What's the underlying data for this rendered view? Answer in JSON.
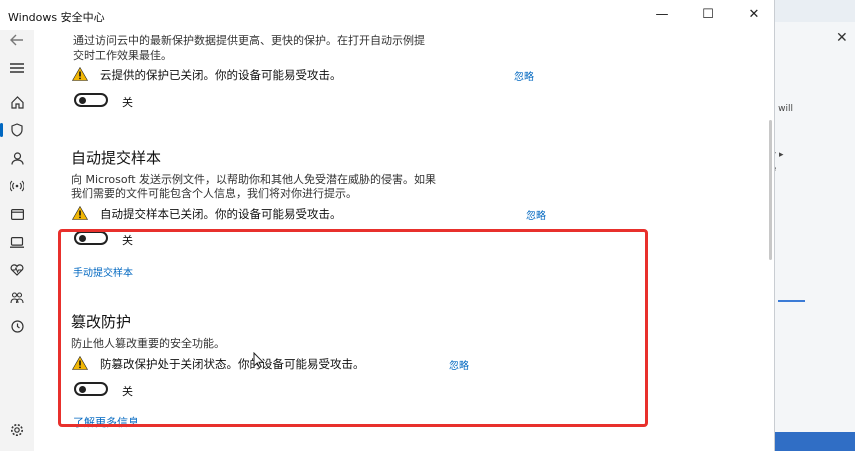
{
  "window": {
    "title": "Windows 安全中心",
    "min_glyph": "—",
    "max_glyph": "☐",
    "close_glyph": "✕"
  },
  "nav_icons": [
    "back-arrow-icon",
    "hamburger-menu-icon",
    "home-icon",
    "shield-icon",
    "account-icon",
    "network-icon",
    "app-browser-icon",
    "device-icon",
    "health-icon",
    "family-icon",
    "history-icon",
    "settings-icon"
  ],
  "cloud_section": {
    "desc_line1": "通过访问云中的最新保护数据提供更高、更快的保护。在打开自动示例提",
    "desc_line2": "交时工作效果最佳。",
    "warning": "云提供的保护已关闭。你的设备可能易受攻击。",
    "dismiss": "忽略",
    "toggle_label": "关"
  },
  "auto_sample": {
    "heading": "自动提交样本",
    "desc_line1": "向 Microsoft 发送示例文件，以帮助你和其他人免受潜在威胁的侵害。如果",
    "desc_line2": "我们需要的文件可能包含个人信息，我们将对你进行提示。",
    "warning": "自动提交样本已关闭。你的设备可能易受攻击。",
    "dismiss": "忽略",
    "toggle_label": "关",
    "manual_link": "手动提交样本"
  },
  "tamper": {
    "heading": "篡改防护",
    "desc": "防止他人篡改重要的安全功能。",
    "warning": "防篡改保护处于关闭状态。你的设备可能易受攻击。",
    "dismiss": "忽略",
    "toggle_label": "关",
    "learn_more": "了解更多信息"
  },
  "background_window": {
    "text1": "y will",
    "text2": "y ▸",
    "text3": "e"
  },
  "colors": {
    "accent": "#0067c0",
    "highlight_box": "#e8302c",
    "warning": "#f2b705"
  }
}
